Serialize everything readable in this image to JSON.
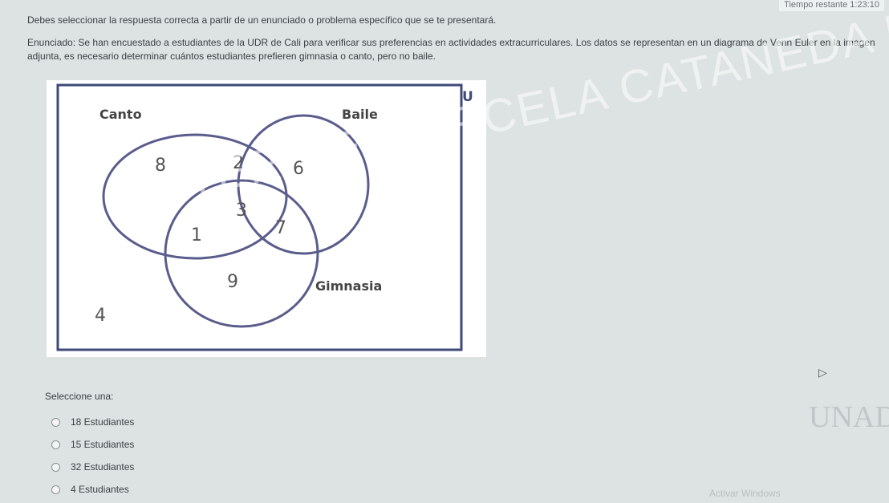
{
  "timer": "Tiempo restante 1:23:10",
  "instruction": "Debes seleccionar la respuesta correcta a partir de un enunciado o problema específico que se te presentará.",
  "statement": "Enunciado: Se han encuestado a estudiantes de la UDR de Cali para verificar sus preferencias en actividades extracurriculares. Los datos se representan en un diagrama de Venn Euler en la imagen adjunta, es necesario determinar cuántos estudiantes prefieren gimnasia o canto, pero no baile.",
  "venn": {
    "universe_label": "U",
    "set_labels": {
      "canto": "Canto",
      "baile": "Baile",
      "gimnasia": "Gimnasia"
    },
    "regions": {
      "canto_only": "8",
      "canto_baile": "2",
      "baile_only": "6",
      "all_three": "3",
      "canto_gimnasia": "1",
      "baile_gimnasia": "7",
      "gimnasia_only": "9",
      "outside": "4"
    },
    "stroke_color": "#5a5d8c",
    "frame_color": "#3e4a78"
  },
  "watermark": "KATERINE MARCELA CATANEDA DIAZ",
  "select_label": "Seleccione una:",
  "options": [
    {
      "label": "18 Estudiantes"
    },
    {
      "label": "15 Estudiantes"
    },
    {
      "label": "32 Estudiantes"
    },
    {
      "label": "4 Estudiantes"
    }
  ],
  "logo_text": "UNAD",
  "activate_text": "Activar Windows"
}
